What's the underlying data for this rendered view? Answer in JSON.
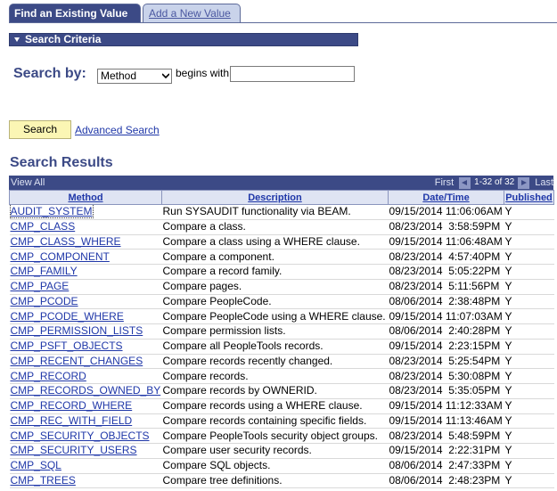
{
  "tabs": {
    "find": "Find an Existing Value",
    "add": "Add a New Value"
  },
  "criteria": {
    "header": "Search Criteria",
    "search_by_label": "Search by:",
    "search_by_value": "Method",
    "operator": "begins with",
    "input_value": "",
    "search_button": "Search",
    "advanced_link": "Advanced Search"
  },
  "results": {
    "title": "Search Results",
    "view_all": "View All",
    "first": "First",
    "count": "1-32 of 32",
    "last": "Last",
    "columns": [
      "Method",
      "Description",
      "Date/Time",
      "Published"
    ],
    "rows": [
      [
        "AUDIT_SYSTEM",
        "Run SYSAUDIT functionality via BEAM.",
        "09/15/2014 11:06:06AM",
        "Y"
      ],
      [
        "CMP_CLASS",
        "Compare a class.",
        "08/23/2014  3:58:59PM",
        "Y"
      ],
      [
        "CMP_CLASS_WHERE",
        "Compare a class using a WHERE clause.",
        "09/15/2014 11:06:48AM",
        "Y"
      ],
      [
        "CMP_COMPONENT",
        "Compare a component.",
        "08/23/2014  4:57:40PM",
        "Y"
      ],
      [
        "CMP_FAMILY",
        "Compare a record family.",
        "08/23/2014  5:05:22PM",
        "Y"
      ],
      [
        "CMP_PAGE",
        "Compare pages.",
        "08/23/2014  5:11:56PM",
        "Y"
      ],
      [
        "CMP_PCODE",
        "Compare PeopleCode.",
        "08/06/2014  2:38:48PM",
        "Y"
      ],
      [
        "CMP_PCODE_WHERE",
        "Compare PeopleCode using a WHERE clause.",
        "09/15/2014 11:07:03AM",
        "Y"
      ],
      [
        "CMP_PERMISSION_LISTS",
        "Compare permission lists.",
        "08/06/2014  2:40:28PM",
        "Y"
      ],
      [
        "CMP_PSFT_OBJECTS",
        "Compare all PeopleTools records.",
        "09/15/2014  2:23:15PM",
        "Y"
      ],
      [
        "CMP_RECENT_CHANGES",
        "Compare records recently changed.",
        "08/23/2014  5:25:54PM",
        "Y"
      ],
      [
        "CMP_RECORD",
        "Compare records.",
        "08/23/2014  5:30:08PM",
        "Y"
      ],
      [
        "CMP_RECORDS_OWNED_BY",
        "Compare records by OWNERID.",
        "08/23/2014  5:35:05PM",
        "Y"
      ],
      [
        "CMP_RECORD_WHERE",
        "Compare records using a WHERE clause.",
        "09/15/2014 11:12:33AM",
        "Y"
      ],
      [
        "CMP_REC_WITH_FIELD",
        "Compare records containing specific fields.",
        "09/15/2014 11:13:46AM",
        "Y"
      ],
      [
        "CMP_SECURITY_OBJECTS",
        "Compare PeopleTools security object groups.",
        "08/23/2014  5:48:59PM",
        "Y"
      ],
      [
        "CMP_SECURITY_USERS",
        "Compare user security records.",
        "09/15/2014  2:22:31PM",
        "Y"
      ],
      [
        "CMP_SQL",
        "Compare SQL objects.",
        "08/06/2014  2:47:33PM",
        "Y"
      ],
      [
        "CMP_TREES",
        "Compare tree definitions.",
        "08/06/2014  2:48:23PM",
        "Y"
      ]
    ]
  }
}
